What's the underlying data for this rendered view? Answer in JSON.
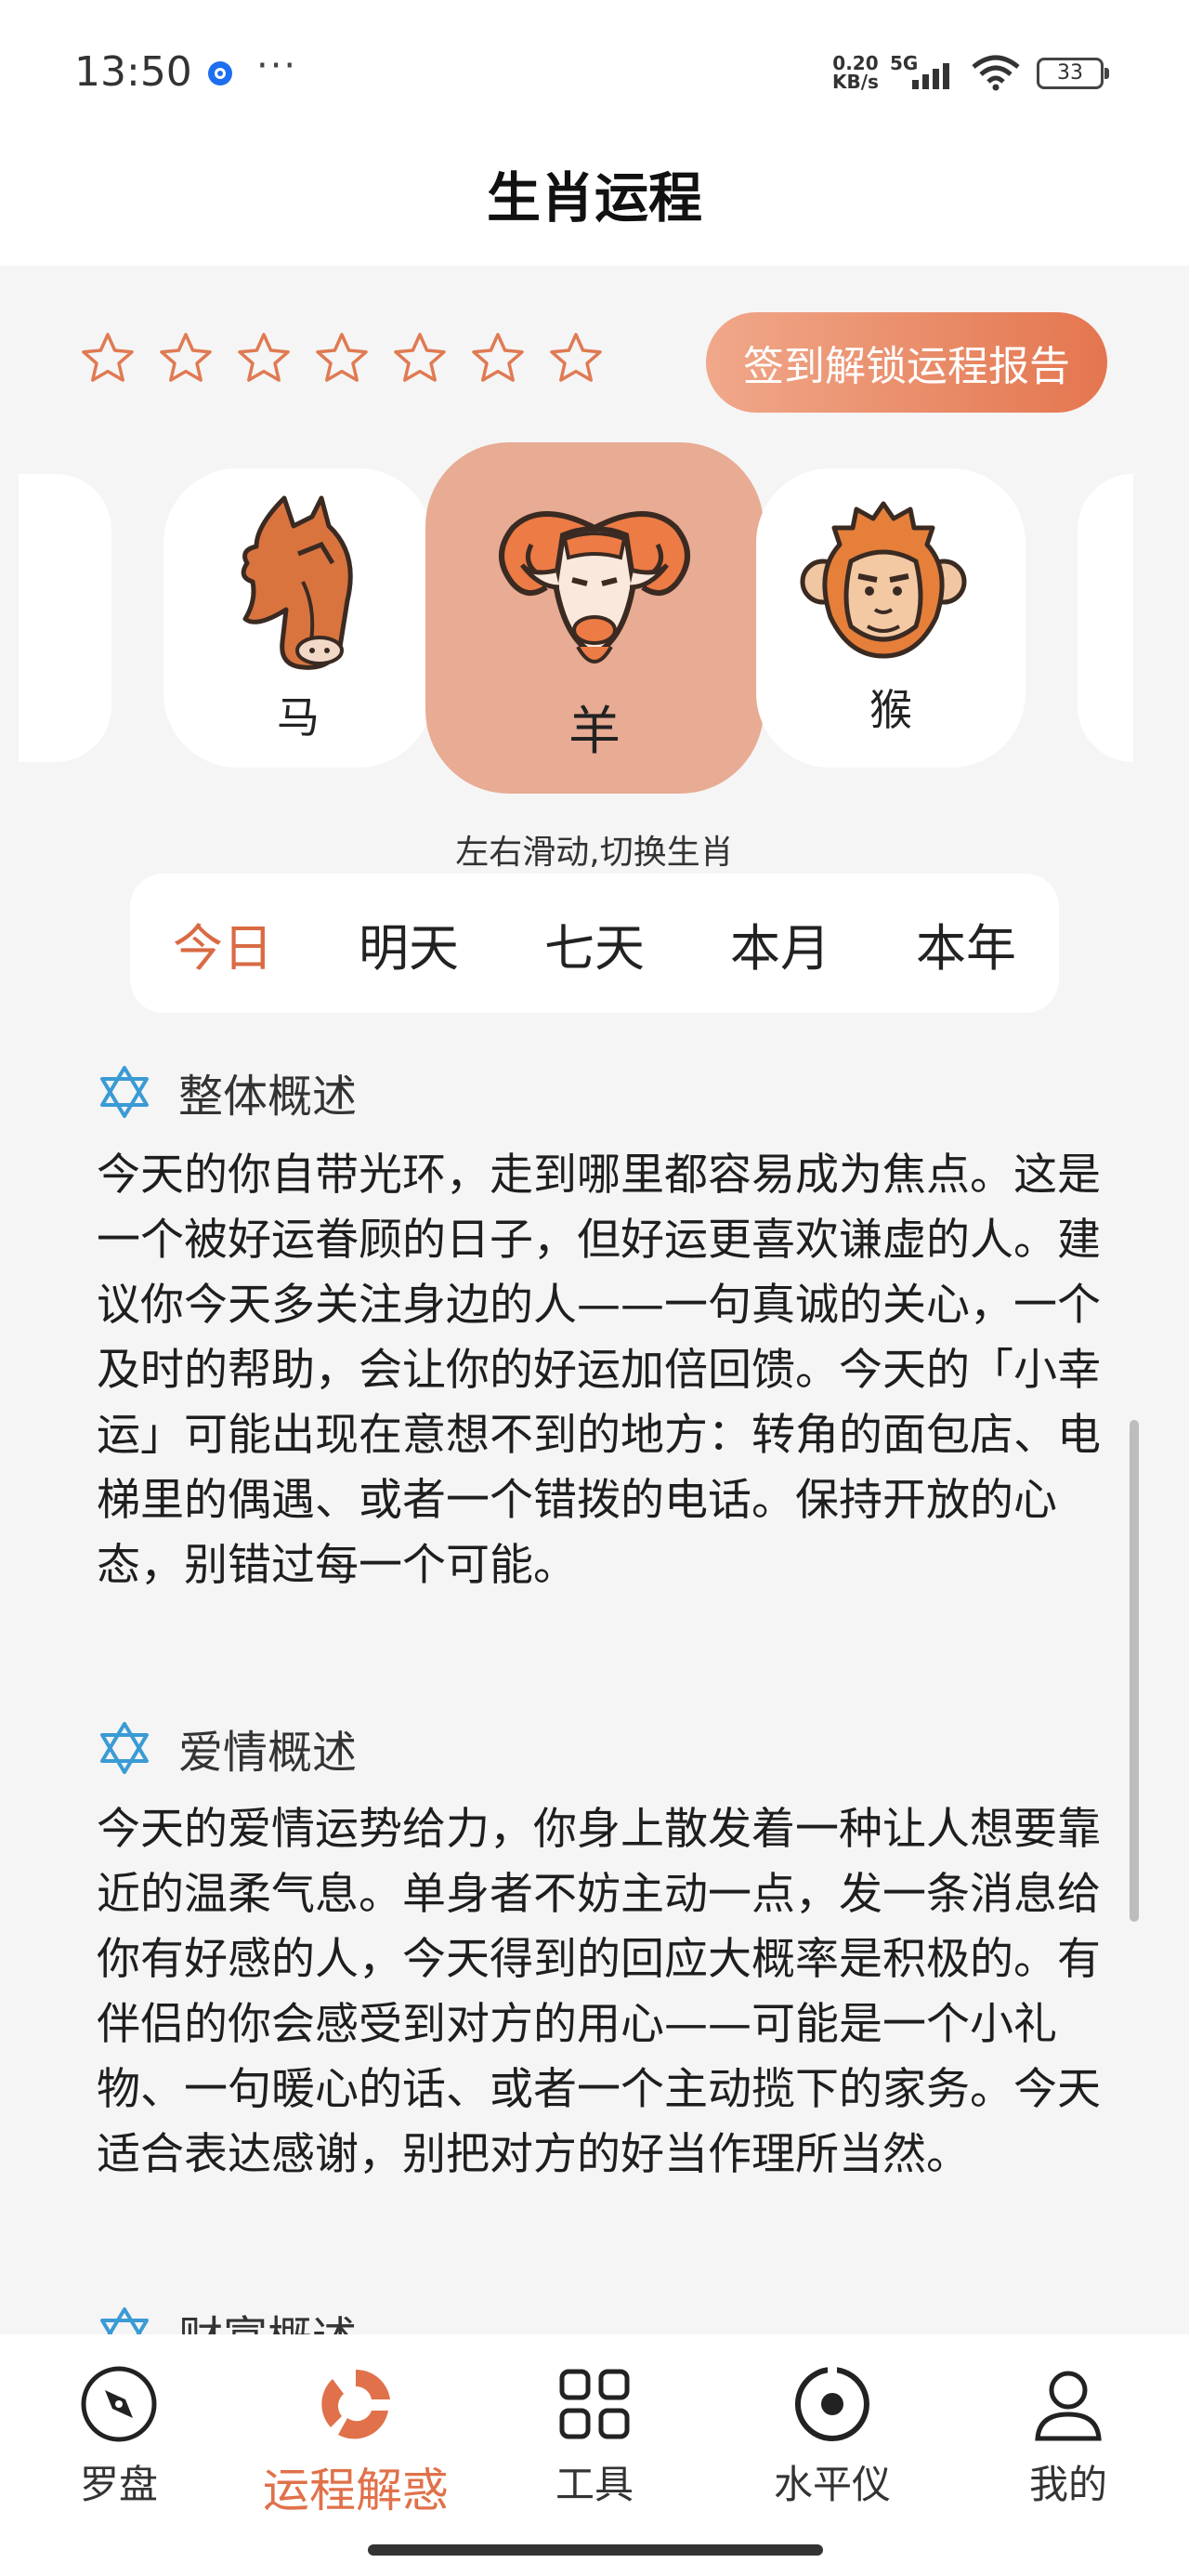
{
  "status_bar": {
    "time": "13:50",
    "net_speed_value": "0.20",
    "net_speed_unit": "KB/s",
    "network": "5G",
    "battery": "33",
    "more": "···"
  },
  "header": {
    "title": "生肖运程"
  },
  "rating": {
    "filled_stars": 0,
    "total_stars": 7,
    "star_color": "#e07a52"
  },
  "unlock_button": {
    "label": "签到解锁运程报告"
  },
  "zodiac": {
    "items": [
      {
        "label": "马",
        "icon": "horse-icon"
      },
      {
        "label": "羊",
        "icon": "goat-icon",
        "selected": true
      },
      {
        "label": "猴",
        "icon": "monkey-icon"
      }
    ],
    "hint": "左右滑动,切换生肖"
  },
  "tabs": [
    {
      "label": "今日",
      "active": true
    },
    {
      "label": "明天"
    },
    {
      "label": "七天"
    },
    {
      "label": "本月"
    },
    {
      "label": "本年"
    }
  ],
  "sections": [
    {
      "title": "整体概述",
      "icon": "star-of-david-icon",
      "body": "今天的你自带光环，走到哪里都容易成为焦点。这是一个被好运眷顾的日子，但好运更喜欢谦虚的人。建议你今天多关注身边的人——一句真诚的关心，一个及时的帮助，会让你的好运加倍回馈。今天的「小幸运」可能出现在意想不到的地方：转角的面包店、电梯里的偶遇、或者一个错拨的电话。保持开放的心态，别错过每一个可能。"
    },
    {
      "title": "爱情概述",
      "icon": "star-of-david-icon",
      "body": "今天的爱情运势给力，你身上散发着一种让人想要靠近的温柔气息。单身者不妨主动一点，发一条消息给你有好感的人，今天得到的回应大概率是积极的。有伴侣的你会感受到对方的用心——可能是一个小礼物、一句暖心的话、或者一个主动揽下的家务。今天适合表达感谢，别把对方的好当作理所当然。"
    },
    {
      "title": "财富概述",
      "icon": "star-of-david-icon"
    }
  ],
  "bottom_nav": [
    {
      "label": "罗盘",
      "icon": "compass-icon"
    },
    {
      "label": "运程解惑",
      "icon": "fortune-icon",
      "active": true
    },
    {
      "label": "工具",
      "icon": "grid-icon"
    },
    {
      "label": "水平仪",
      "icon": "level-icon"
    },
    {
      "label": "我的",
      "icon": "user-icon"
    }
  ],
  "colors": {
    "accent": "#e0714a",
    "selected_card": "#e8ab93",
    "section_icon": "#3a9bd5"
  }
}
